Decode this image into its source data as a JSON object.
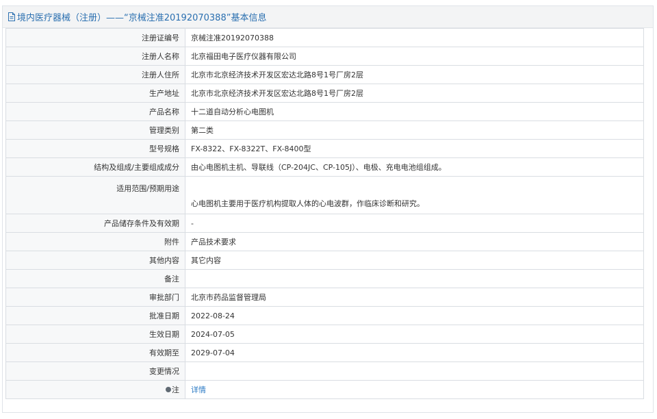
{
  "header": {
    "title": "境内医疗器械（注册）——“京械注准20192070388”基本信息",
    "icon": "document-icon"
  },
  "rows": [
    {
      "label": "注册证编号",
      "value": "京械注准20192070388"
    },
    {
      "label": "注册人名称",
      "value": "北京福田电子医疗仪器有限公司"
    },
    {
      "label": "注册人住所",
      "value": "北京市北京经济技术开发区宏达北路8号1号厂房2层"
    },
    {
      "label": "生产地址",
      "value": "北京市北京经济技术开发区宏达北路8号1号厂房2层"
    },
    {
      "label": "产品名称",
      "value": "十二道自动分析心电图机"
    },
    {
      "label": "管理类别",
      "value": "第二类"
    },
    {
      "label": "型号规格",
      "value": "FX-8322、FX-8322T、FX-8400型"
    },
    {
      "label": "结构及组成/主要组成成分",
      "value": "由心电图机主机、导联线（CP-204JC、CP-105J）、电极、充电电池组组成。"
    },
    {
      "label": "适用范围/预期用途",
      "value": "心电图机主要用于医疗机构提取人体的心电波群，作临床诊断和研究。"
    },
    {
      "label": "产品储存条件及有效期",
      "value": "-"
    },
    {
      "label": "附件",
      "value": "产品技术要求"
    },
    {
      "label": "其他内容",
      "value": "其它内容"
    },
    {
      "label": "备注",
      "value": ""
    },
    {
      "label": "审批部门",
      "value": "北京市药品监督管理局"
    },
    {
      "label": "批准日期",
      "value": "2022-08-24"
    },
    {
      "label": "生效日期",
      "value": "2024-07-05"
    },
    {
      "label": "有效期至",
      "value": "2029-07-04"
    },
    {
      "label": "变更情况",
      "value": ""
    }
  ],
  "note_row": {
    "label": "注",
    "icon": "pin-icon",
    "link_text": "详情"
  },
  "colors": {
    "header_text": "#2a6fb0",
    "link": "#2a79c4",
    "border": "#d9dde2",
    "label_bg": "#f7f8f9"
  }
}
